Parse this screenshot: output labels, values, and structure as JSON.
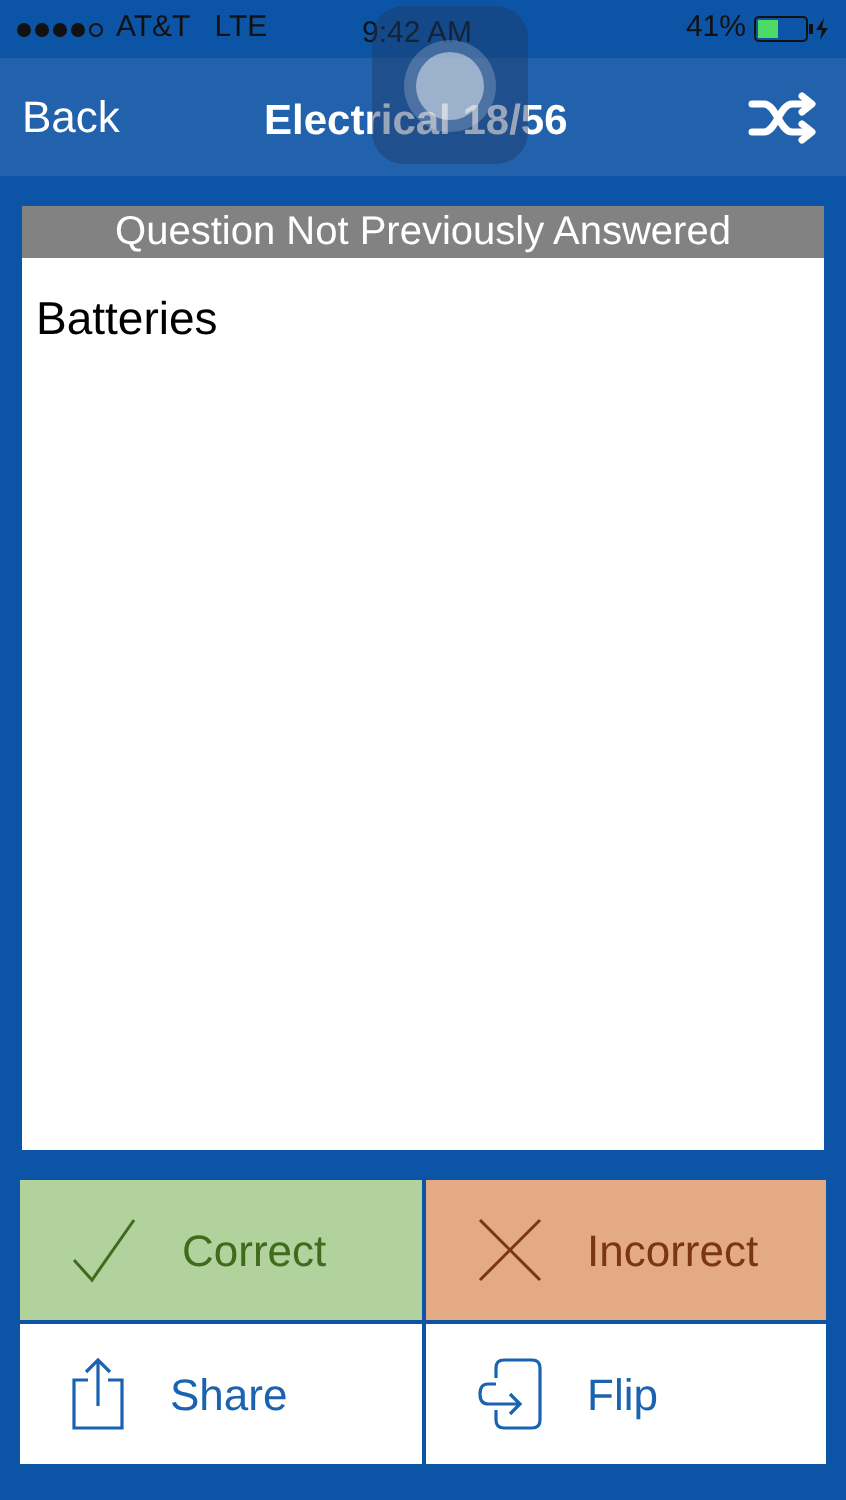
{
  "status_bar": {
    "carrier": "AT&T",
    "network": "LTE",
    "time": "9:42 AM",
    "battery_percent": "41%"
  },
  "nav_bar": {
    "back": "Back",
    "title": "Electrical 18/56"
  },
  "card": {
    "banner": "Question Not Previously Answered",
    "text": "Batteries"
  },
  "buttons": [
    {
      "kind": "correct",
      "label": "Correct"
    },
    {
      "kind": "incorrect",
      "label": "Incorrect"
    },
    {
      "kind": "share",
      "label": "Share"
    },
    {
      "kind": "flip",
      "label": "Flip"
    }
  ]
}
